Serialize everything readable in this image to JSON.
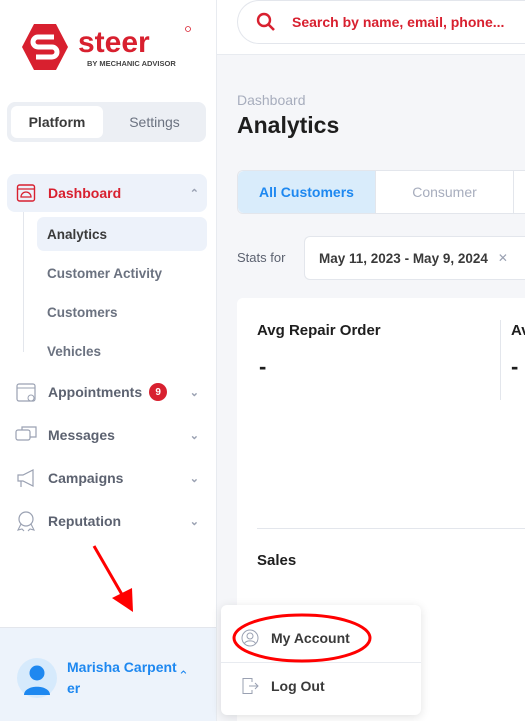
{
  "brand": {
    "name": "steer",
    "tagline": "BY MECHANIC ADVISOR",
    "color": "#d8202f"
  },
  "sidebar": {
    "segments": [
      {
        "label": "Platform",
        "active": true
      },
      {
        "label": "Settings",
        "active": false
      }
    ],
    "dashboard": {
      "label": "Dashboard",
      "icon": "dashboard-icon",
      "expanded": true,
      "children": [
        {
          "label": "Analytics",
          "active": true
        },
        {
          "label": "Customer Activity"
        },
        {
          "label": "Customers"
        },
        {
          "label": "Vehicles"
        }
      ]
    },
    "items": [
      {
        "label": "Appointments",
        "icon": "calendar-icon",
        "badge": "9"
      },
      {
        "label": "Messages",
        "icon": "chat-icon"
      },
      {
        "label": "Campaigns",
        "icon": "megaphone-icon"
      },
      {
        "label": "Reputation",
        "icon": "award-icon"
      }
    ],
    "user": {
      "name": "Marisha Carpenter"
    }
  },
  "search": {
    "placeholder": "Search by name, email, phone..."
  },
  "main": {
    "breadcrumb": "Dashboard",
    "title": "Analytics",
    "tabs": [
      {
        "label": "All Customers",
        "active": true
      },
      {
        "label": "Consumer"
      }
    ],
    "stats_label": "Stats for",
    "date_range": "May 11, 2023 - May 9, 2024",
    "cards": [
      {
        "title": "Avg Repair Order",
        "value": "-"
      },
      {
        "title": "Av",
        "value": "-"
      }
    ],
    "sales_title": "Sales"
  },
  "user_menu": [
    {
      "label": "My Account",
      "icon": "user-circle-icon"
    },
    {
      "label": "Log Out",
      "icon": "logout-icon"
    }
  ],
  "annotation_color": "#ff0000"
}
